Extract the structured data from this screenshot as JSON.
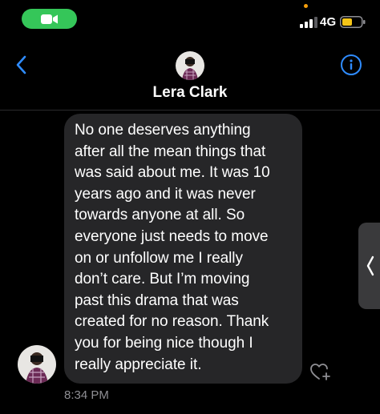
{
  "status_bar": {
    "facetime_icon": "video-camera-icon",
    "network": "4G",
    "colors": {
      "facetime": "#35c659",
      "battery": "#f5c518",
      "mic_indicator": "#f59e0b"
    }
  },
  "header": {
    "back_icon": "chevron-left-icon",
    "contact_name": "Lera Clark",
    "info_icon": "info-icon",
    "accent": "#2f8cff"
  },
  "message": {
    "lines": [
      "No one deserves anything",
      "after all the mean things that",
      "was said about me. It was 10",
      "years ago and it was never",
      "towards anyone at all. So",
      "everyone just needs to move",
      "on or unfollow me I really",
      "don’t care. But I’m moving",
      "past this drama that was",
      "created for no reason. Thank",
      "you for being nice though I",
      "really appreciate it."
    ],
    "timestamp": "8:34 PM",
    "react_icon": "heart-plus-icon"
  },
  "side_tab": {
    "icon": "chevron-left-icon"
  }
}
